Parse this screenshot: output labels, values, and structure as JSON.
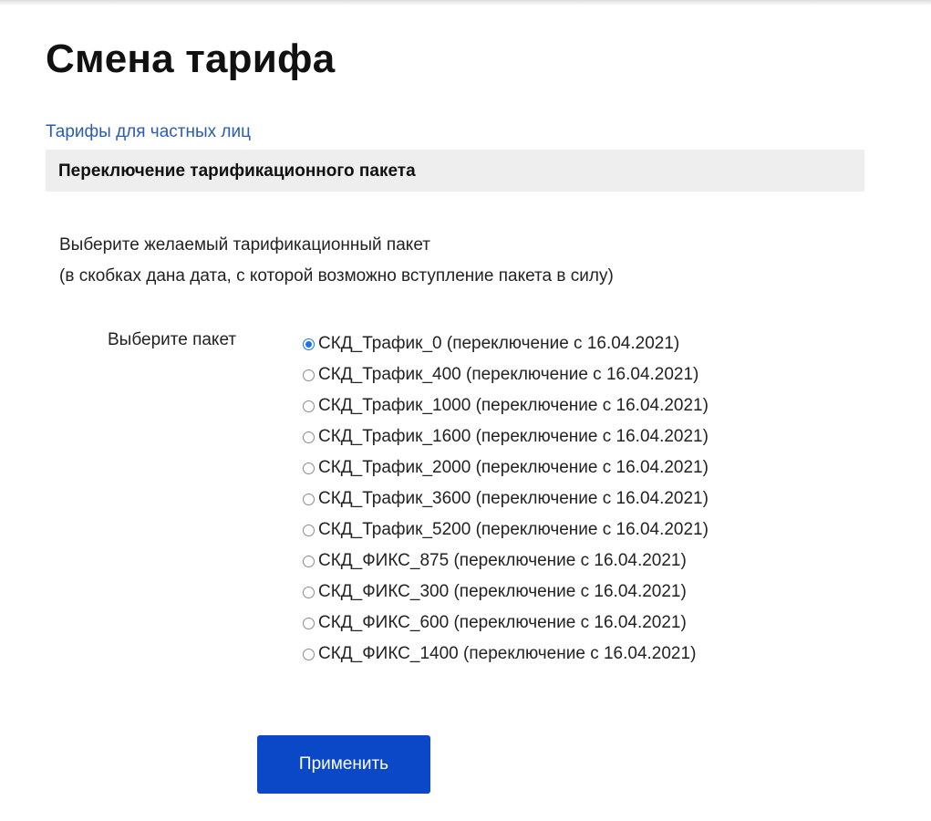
{
  "page": {
    "title": "Смена тарифа",
    "breadcrumb_link": "Тарифы для частных лиц",
    "section_title": "Переключение тарификационного пакета",
    "intro_line1": "Выберите желаемый тарификационный пакет",
    "intro_line2": "(в скобках дана дата, с которой возможно вступление пакета в силу)"
  },
  "form": {
    "field_label": "Выберите пакет",
    "selected_index": 0,
    "options": [
      {
        "label": "СКД_Трафик_0 (переключение с 16.04.2021)",
        "checked": true
      },
      {
        "label": "СКД_Трафик_400 (переключение с 16.04.2021)",
        "checked": false
      },
      {
        "label": "СКД_Трафик_1000 (переключение с 16.04.2021)",
        "checked": false
      },
      {
        "label": "СКД_Трафик_1600 (переключение с 16.04.2021)",
        "checked": false
      },
      {
        "label": "СКД_Трафик_2000 (переключение с 16.04.2021)",
        "checked": false
      },
      {
        "label": "СКД_Трафик_3600 (переключение с 16.04.2021)",
        "checked": false
      },
      {
        "label": "СКД_Трафик_5200 (переключение с 16.04.2021)",
        "checked": false
      },
      {
        "label": "СКД_ФИКС_875 (переключение с 16.04.2021)",
        "checked": false
      },
      {
        "label": "СКД_ФИКС_300 (переключение с 16.04.2021)",
        "checked": false
      },
      {
        "label": "СКД_ФИКС_600 (переключение с 16.04.2021)",
        "checked": false
      },
      {
        "label": "СКД_ФИКС_1400 (переключение с 16.04.2021)",
        "checked": false
      }
    ],
    "submit_label": "Применить"
  },
  "colors": {
    "link": "#2a5db0",
    "button": "#0a48c7",
    "section_bg": "#eeeeee",
    "radio_checked": "#1a73e8"
  }
}
